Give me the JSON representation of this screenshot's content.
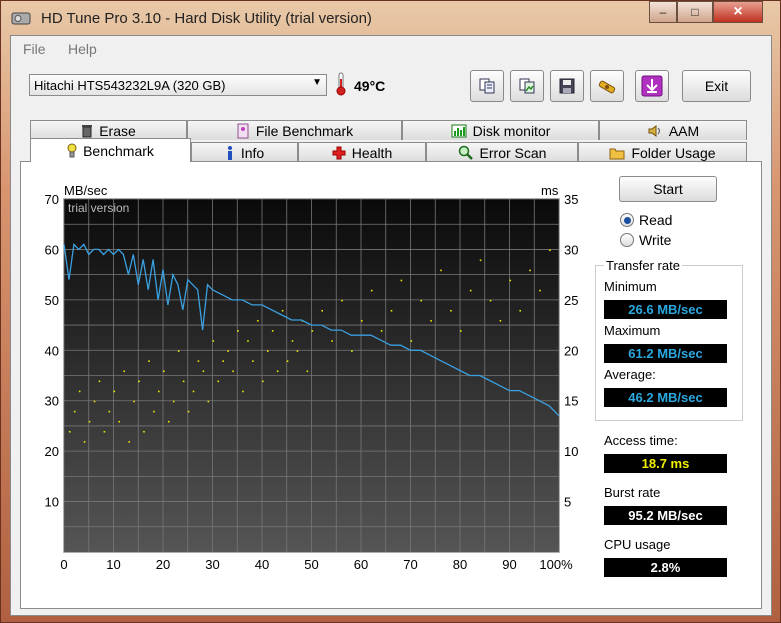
{
  "window": {
    "title": "HD Tune Pro 3.10 - Hard Disk Utility (trial version)",
    "minimize": "–",
    "maximize": "□",
    "close": "×"
  },
  "menu": {
    "file": "File",
    "help": "Help"
  },
  "toolbar": {
    "drive": "Hitachi HTS543232L9A (320 GB)",
    "temperature": "49°C",
    "exit_label": "Exit",
    "icons": [
      "copy-text-icon",
      "copy-image-icon",
      "save-icon",
      "options-icon",
      "download-icon"
    ]
  },
  "tabs": {
    "row1": [
      "Erase",
      "File Benchmark",
      "Disk monitor",
      "AAM"
    ],
    "row2": [
      "Benchmark",
      "Info",
      "Health",
      "Error Scan",
      "Folder Usage"
    ],
    "active": "Benchmark"
  },
  "controls": {
    "start_label": "Start",
    "read_label": "Read",
    "write_label": "Write",
    "selected_mode": "Read"
  },
  "results": {
    "transfer_rate_title": "Transfer rate",
    "minimum_label": "Minimum",
    "minimum_value": "26.6 MB/sec",
    "maximum_label": "Maximum",
    "maximum_value": "61.2 MB/sec",
    "average_label": "Average:",
    "average_value": "46.2 MB/sec",
    "access_label": "Access time:",
    "access_value": "18.7 ms",
    "burst_label": "Burst rate",
    "burst_value": "95.2 MB/sec",
    "cpu_label": "CPU usage",
    "cpu_value": "2.8%"
  },
  "colors": {
    "transfer_line": "#3aa0e0",
    "access_points": "#e8e800",
    "chart_bg_top": "#0a0a0a",
    "chart_bg_bottom": "#555555"
  },
  "chart_data": {
    "type": "line",
    "watermark": "trial version",
    "ylabel_left": "MB/sec",
    "ylabel_right": "ms",
    "xlim": [
      0,
      100
    ],
    "ylim_left": [
      0,
      70
    ],
    "ylim_right": [
      0,
      35
    ],
    "x_ticks": [
      "0",
      "10",
      "20",
      "30",
      "40",
      "50",
      "60",
      "70",
      "80",
      "90",
      "100%"
    ],
    "y_ticks_left": [
      "10",
      "20",
      "30",
      "40",
      "50",
      "60",
      "70"
    ],
    "y_ticks_right": [
      "5",
      "10",
      "15",
      "20",
      "25",
      "30",
      "35"
    ],
    "grid": true,
    "series": [
      {
        "name": "Transfer rate",
        "x": [
          0,
          1,
          2,
          3,
          4,
          5,
          6,
          7,
          8,
          9,
          10,
          11,
          12,
          13,
          14,
          15,
          16,
          17,
          18,
          19,
          20,
          21,
          22,
          23,
          24,
          25,
          26,
          27,
          28,
          29,
          30,
          32,
          34,
          36,
          38,
          40,
          42,
          44,
          46,
          48,
          50,
          52,
          54,
          56,
          58,
          60,
          62,
          64,
          66,
          68,
          70,
          72,
          74,
          76,
          78,
          80,
          82,
          84,
          86,
          88,
          90,
          92,
          94,
          96,
          98,
          100
        ],
        "values": [
          61,
          54,
          61,
          60,
          61,
          59,
          60,
          60,
          59,
          60,
          59,
          60,
          59,
          55,
          59,
          53,
          58,
          52,
          58,
          50,
          56,
          49,
          55,
          53,
          48,
          54,
          53,
          52,
          44,
          53,
          52,
          51,
          50,
          50,
          49,
          49,
          48,
          47,
          46,
          46,
          45,
          45,
          44,
          44,
          43,
          43,
          43,
          42,
          41,
          41,
          40,
          40,
          39,
          38,
          37,
          36,
          35,
          35,
          34,
          33,
          32,
          32,
          31,
          30,
          29,
          27
        ]
      }
    ],
    "access_time_points": [
      [
        1,
        12
      ],
      [
        2,
        14
      ],
      [
        3,
        16
      ],
      [
        4,
        11
      ],
      [
        5,
        13
      ],
      [
        6,
        15
      ],
      [
        7,
        17
      ],
      [
        8,
        12
      ],
      [
        9,
        14
      ],
      [
        10,
        16
      ],
      [
        11,
        13
      ],
      [
        12,
        18
      ],
      [
        13,
        11
      ],
      [
        14,
        15
      ],
      [
        15,
        17
      ],
      [
        16,
        12
      ],
      [
        17,
        19
      ],
      [
        18,
        14
      ],
      [
        19,
        16
      ],
      [
        20,
        18
      ],
      [
        21,
        13
      ],
      [
        22,
        15
      ],
      [
        23,
        20
      ],
      [
        24,
        17
      ],
      [
        25,
        14
      ],
      [
        26,
        16
      ],
      [
        27,
        19
      ],
      [
        28,
        18
      ],
      [
        29,
        15
      ],
      [
        30,
        21
      ],
      [
        31,
        17
      ],
      [
        32,
        19
      ],
      [
        33,
        20
      ],
      [
        34,
        18
      ],
      [
        35,
        22
      ],
      [
        36,
        16
      ],
      [
        37,
        21
      ],
      [
        38,
        19
      ],
      [
        39,
        23
      ],
      [
        40,
        17
      ],
      [
        41,
        20
      ],
      [
        42,
        22
      ],
      [
        43,
        18
      ],
      [
        44,
        24
      ],
      [
        45,
        19
      ],
      [
        46,
        21
      ],
      [
        47,
        20
      ],
      [
        48,
        23
      ],
      [
        49,
        18
      ],
      [
        50,
        22
      ],
      [
        52,
        24
      ],
      [
        54,
        21
      ],
      [
        56,
        25
      ],
      [
        58,
        20
      ],
      [
        60,
        23
      ],
      [
        62,
        26
      ],
      [
        64,
        22
      ],
      [
        66,
        24
      ],
      [
        68,
        27
      ],
      [
        70,
        21
      ],
      [
        72,
        25
      ],
      [
        74,
        23
      ],
      [
        76,
        28
      ],
      [
        78,
        24
      ],
      [
        80,
        22
      ],
      [
        82,
        26
      ],
      [
        84,
        29
      ],
      [
        86,
        25
      ],
      [
        88,
        23
      ],
      [
        90,
        27
      ],
      [
        92,
        24
      ],
      [
        94,
        28
      ],
      [
        96,
        26
      ],
      [
        98,
        30
      ]
    ]
  }
}
